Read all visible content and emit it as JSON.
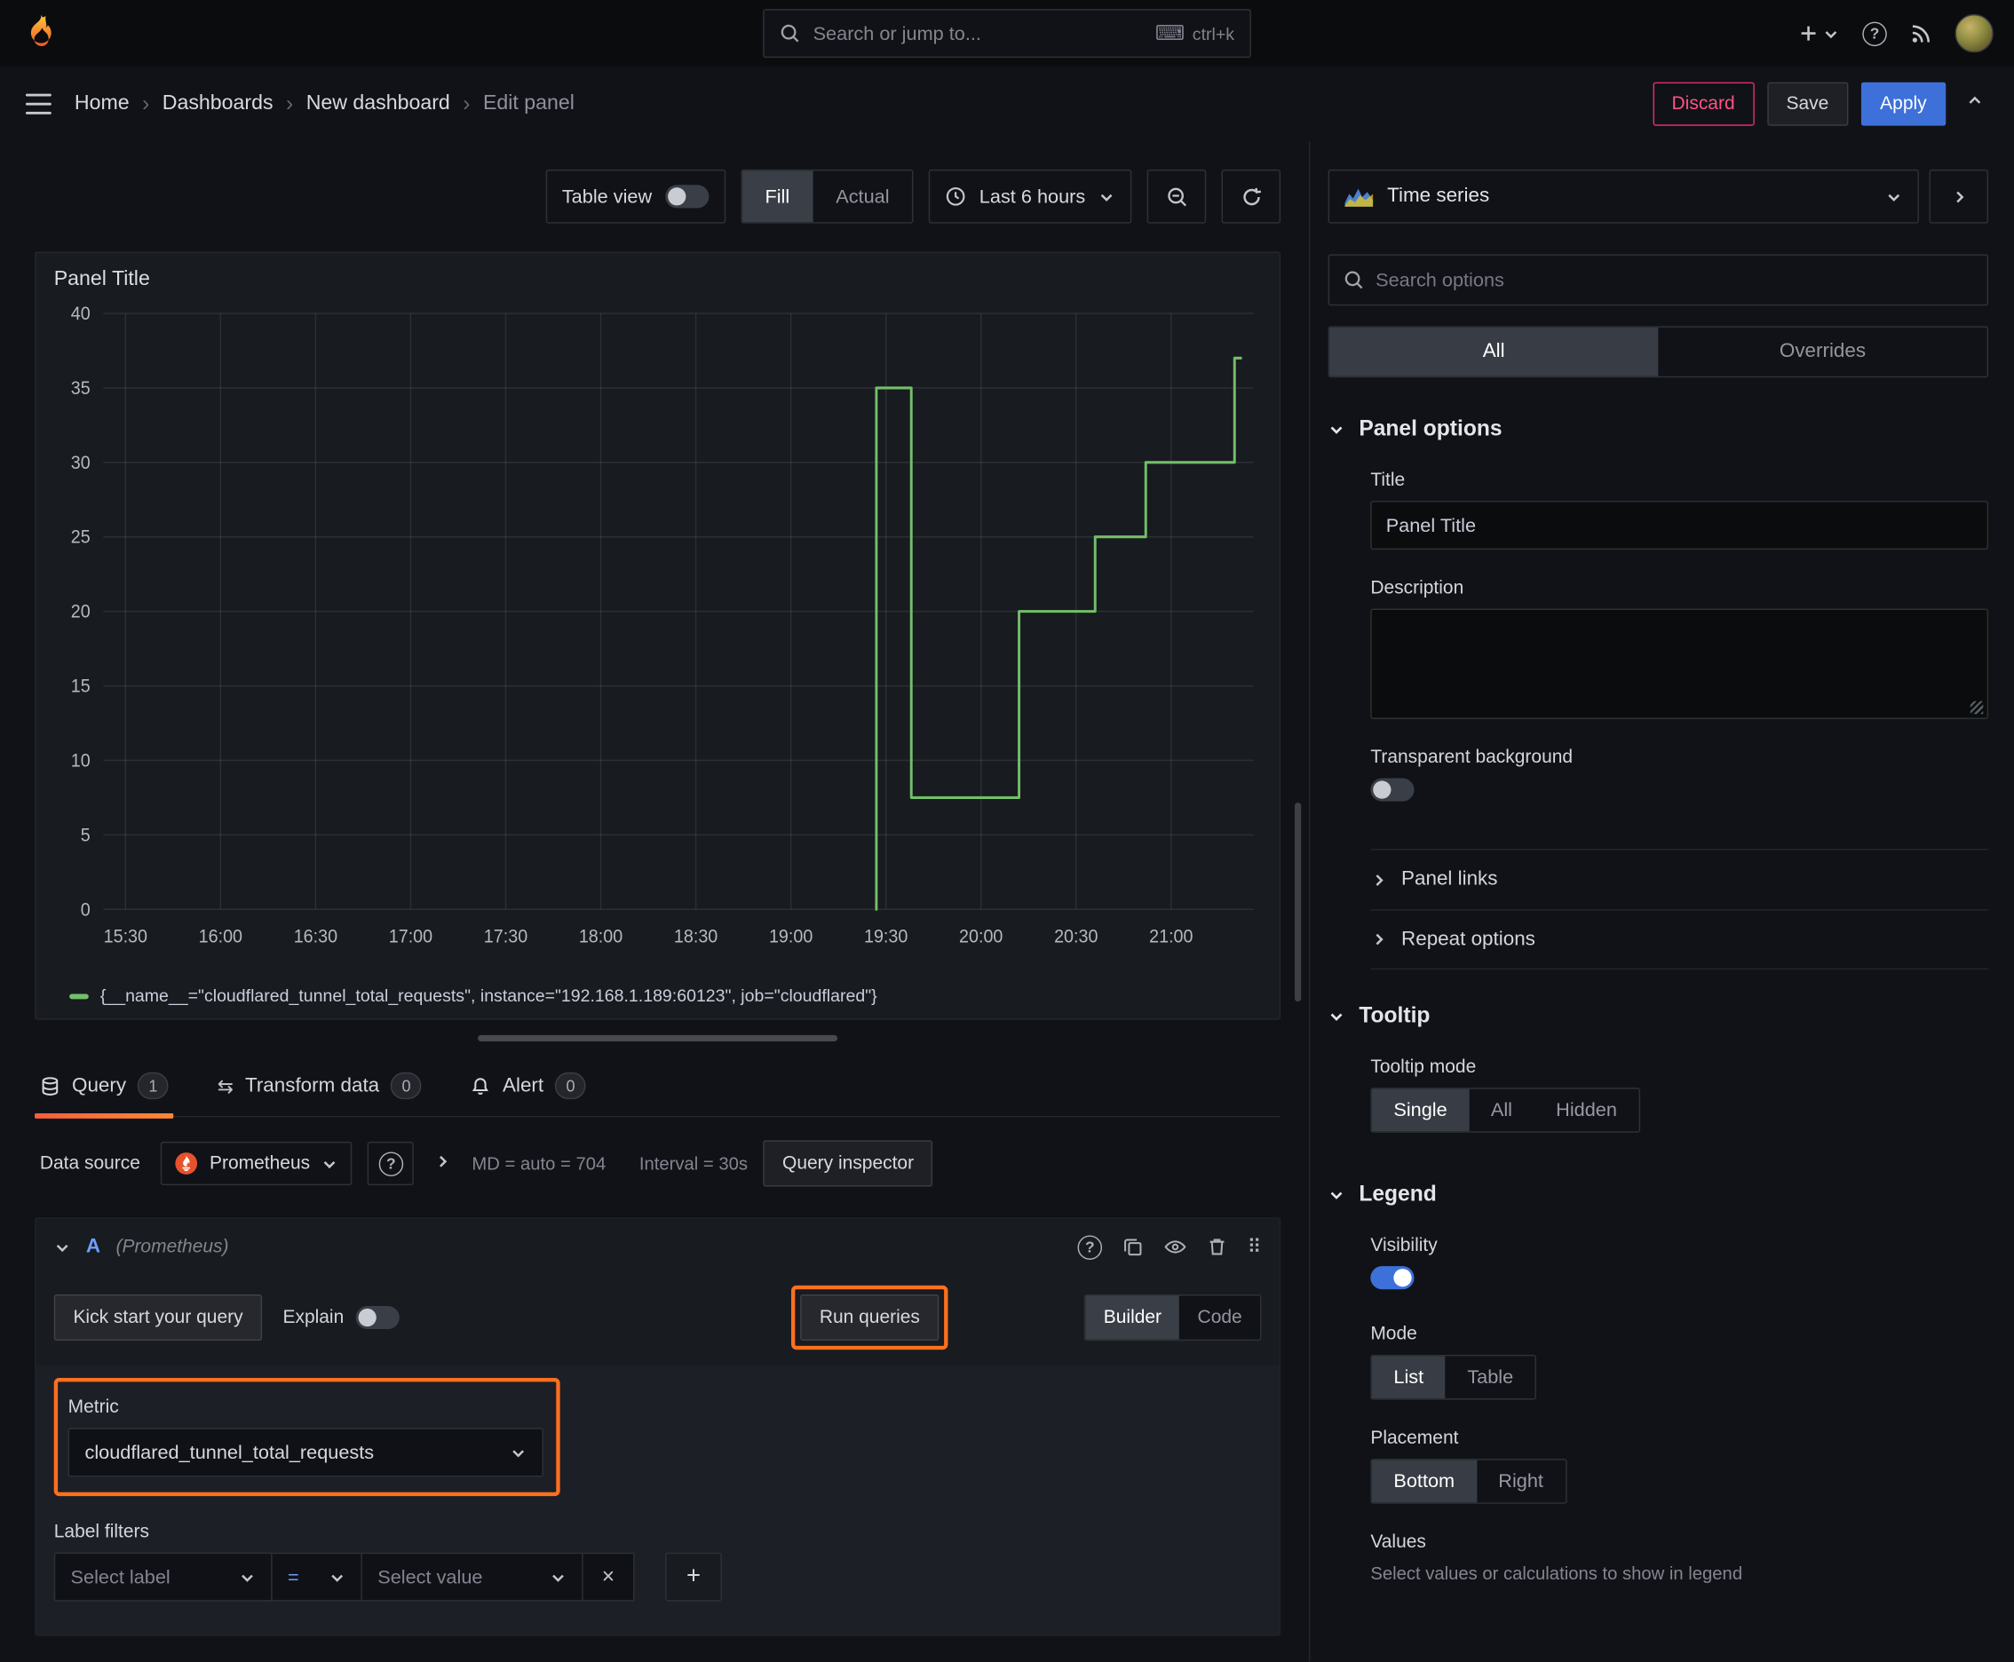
{
  "topnav": {
    "search_placeholder": "Search or jump to...",
    "search_shortcut": "ctrl+k"
  },
  "breadcrumb": {
    "items": [
      "Home",
      "Dashboards",
      "New dashboard",
      "Edit panel"
    ],
    "discard": "Discard",
    "save": "Save",
    "apply": "Apply"
  },
  "toolbar": {
    "table_view": "Table view",
    "fill": "Fill",
    "actual": "Actual",
    "time_range": "Last 6 hours"
  },
  "panel": {
    "title": "Panel Title",
    "legend": "{__name__=\"cloudflared_tunnel_total_requests\", instance=\"192.168.1.189:60123\", job=\"cloudflared\"}"
  },
  "chart_data": {
    "type": "line",
    "title": "Panel Title",
    "x_ticks": [
      "15:30",
      "16:00",
      "16:30",
      "17:00",
      "17:30",
      "18:00",
      "18:30",
      "19:00",
      "19:30",
      "20:00",
      "20:30",
      "21:00"
    ],
    "x_tick_step_minutes": 30,
    "x_range_minutes": [
      -7,
      356
    ],
    "y_ticks": [
      0,
      5,
      10,
      15,
      20,
      25,
      30,
      35,
      40
    ],
    "ylim": [
      0,
      40
    ],
    "grid": true,
    "line_color": "#73bf69",
    "legend_position": "bottom",
    "series": [
      {
        "name": "{__name__=\"cloudflared_tunnel_total_requests\", instance=\"192.168.1.189:60123\", job=\"cloudflared\"}",
        "points_min_value": [
          [
            237,
            0
          ],
          [
            237,
            35
          ],
          [
            248,
            35
          ],
          [
            248,
            7.5
          ],
          [
            282,
            7.5
          ],
          [
            282,
            20
          ],
          [
            306,
            20
          ],
          [
            306,
            25
          ],
          [
            322,
            25
          ],
          [
            322,
            30
          ],
          [
            350,
            30
          ],
          [
            350,
            37
          ],
          [
            352,
            37
          ]
        ]
      }
    ]
  },
  "tabs": {
    "query": "Query",
    "query_count": "1",
    "transform": "Transform data",
    "transform_count": "0",
    "alert": "Alert",
    "alert_count": "0"
  },
  "query": {
    "datasource_label": "Data source",
    "datasource_value": "Prometheus",
    "md_text": "MD = auto = 704",
    "interval_text": "Interval = 30s",
    "query_inspector": "Query inspector",
    "ref_id": "A",
    "ref_hint": "(Prometheus)",
    "kick_start": "Kick start your query",
    "explain": "Explain",
    "run_queries": "Run queries",
    "builder": "Builder",
    "code": "Code",
    "metric_label": "Metric",
    "metric_value": "cloudflared_tunnel_total_requests",
    "label_filters": "Label filters",
    "select_label": "Select label",
    "operator": "=",
    "select_value": "Select value"
  },
  "options": {
    "viz_type": "Time series",
    "search_placeholder": "Search options",
    "tab_all": "All",
    "tab_overrides": "Overrides",
    "panel_options": "Panel options",
    "title_label": "Title",
    "title_value": "Panel Title",
    "description_label": "Description",
    "transparent_bg": "Transparent background",
    "panel_links": "Panel links",
    "repeat_options": "Repeat options",
    "tooltip": "Tooltip",
    "tooltip_mode": "Tooltip mode",
    "tooltip_single": "Single",
    "tooltip_all": "All",
    "tooltip_hidden": "Hidden",
    "legend": "Legend",
    "visibility": "Visibility",
    "mode": "Mode",
    "mode_list": "List",
    "mode_table": "Table",
    "placement": "Placement",
    "placement_bottom": "Bottom",
    "placement_right": "Right",
    "values": "Values",
    "values_hint": "Select values or calculations to show in legend"
  },
  "colors": {
    "accent_orange": "#ff6f1f",
    "tab_gradient_start": "#f55f3e",
    "tab_gradient_end": "#ff8833",
    "primary_blue": "#3d71d9",
    "series_green": "#73bf69",
    "danger_pink": "#ff5286",
    "panel_bg": "#181b1f",
    "page_bg": "#111217"
  }
}
